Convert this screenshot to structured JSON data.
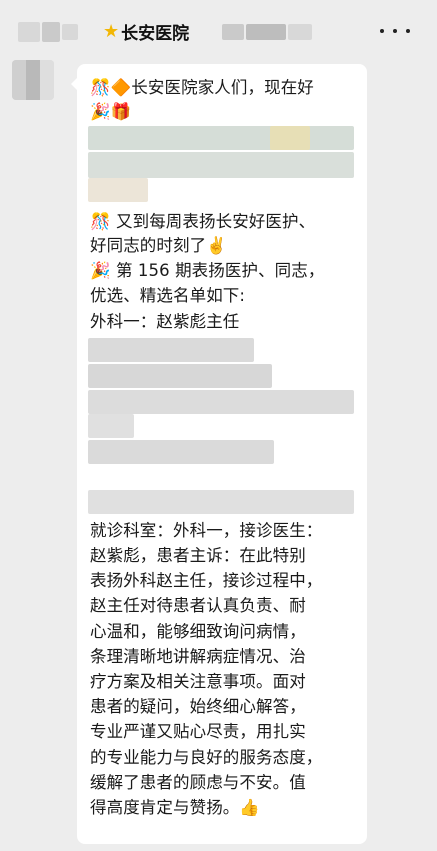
{
  "header": {
    "title": "长安医院",
    "star_icon": "★",
    "more_icon": "more-dots"
  },
  "message": {
    "greeting_line1": "🎊🔶长安医院家人们，现在好",
    "greeting_line2": "🎉🎁",
    "intro_line1": "🎊 又到每周表扬长安好医护、",
    "intro_line2": "好同志的时刻了✌️",
    "issue_line1": "🎉 第 156 期表扬医护、同志，",
    "issue_line2": "优选、精选名单如下:",
    "first_entry": "外科一：赵紫彪主任",
    "detail_lines": [
      "就诊科室：外科一，接诊医生：",
      "赵紫彪，患者主诉：在此特别",
      "表扬外科赵主任，接诊过程中，",
      "赵主任对待患者认真负责、耐",
      "心温和，能够细致询问病情，",
      "条理清晰地讲解病症情况、治",
      "疗方案及相关注意事项。面对",
      "患者的疑问，始终细心解答，",
      "专业严谨又贴心尽责，用扎实",
      "的专业能力与良好的服务态度，",
      "缓解了患者的顾虑与不安。值",
      "得高度肯定与赞扬。👍"
    ]
  }
}
